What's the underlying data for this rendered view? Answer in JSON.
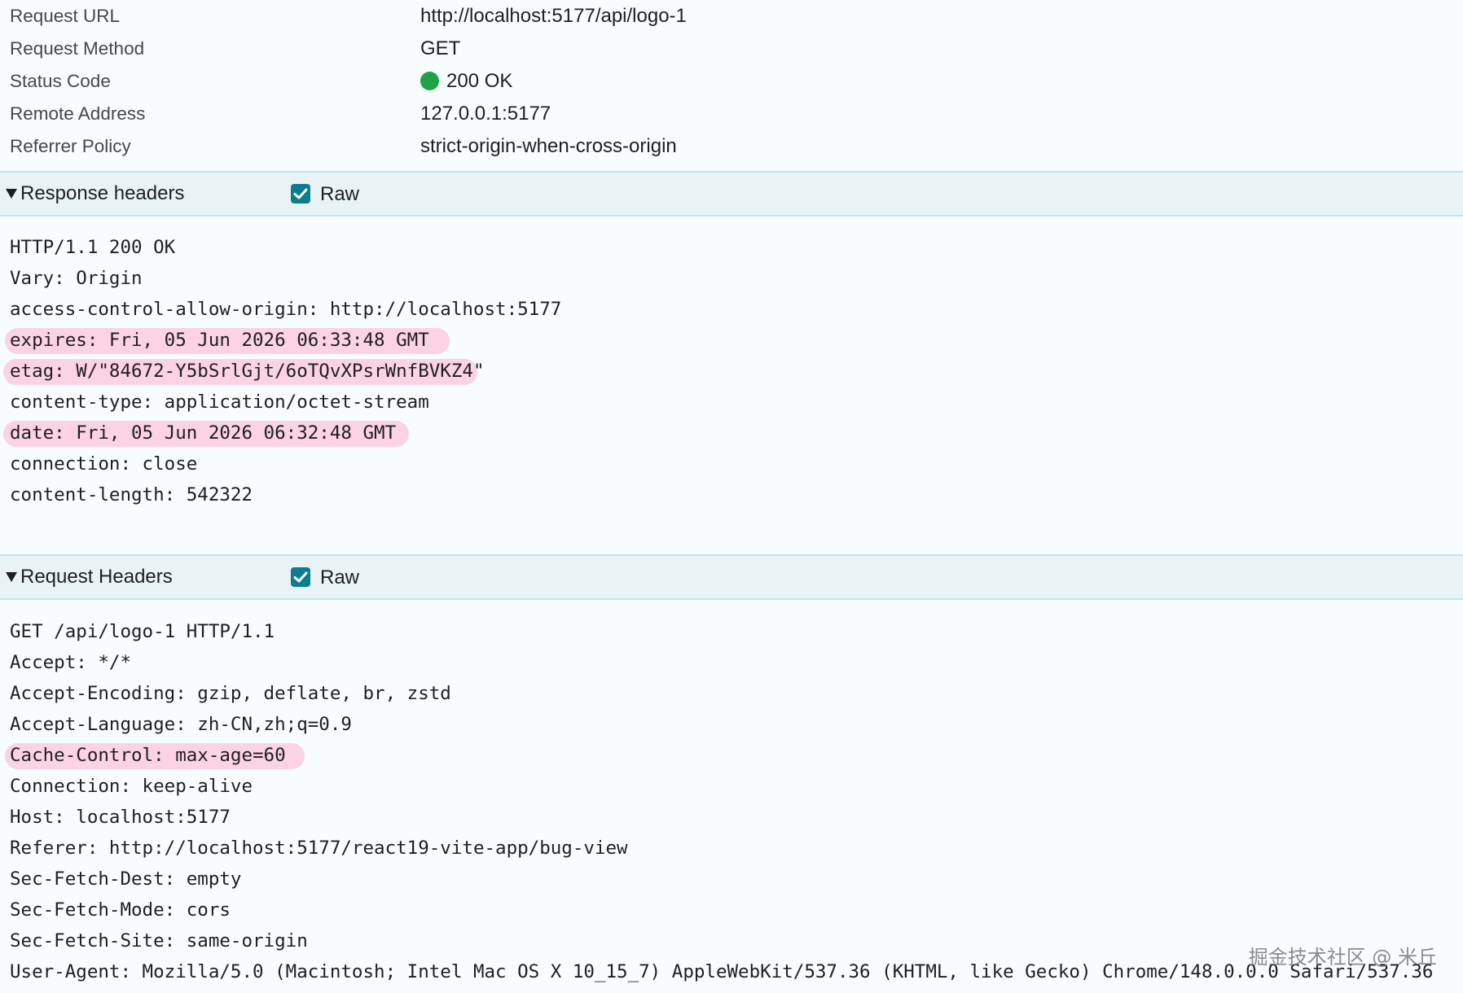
{
  "general": [
    {
      "key": "Request URL",
      "value": "http://localhost:5177/api/logo-1"
    },
    {
      "key": "Request Method",
      "value": "GET"
    },
    {
      "key": "Status Code",
      "value": "200 OK"
    },
    {
      "key": "Remote Address",
      "value": "127.0.0.1:5177"
    },
    {
      "key": "Referrer Policy",
      "value": "strict-origin-when-cross-origin"
    }
  ],
  "status_color": "#1ea446",
  "highlight_color": "#fbd3e3",
  "checkbox_color": "#0b7d8f",
  "response_headers": {
    "title": "Response headers",
    "raw_label": "Raw",
    "raw_checked": true,
    "lines": [
      "HTTP/1.1 200 OK",
      "Vary: Origin",
      "access-control-allow-origin: http://localhost:5177",
      "expires: Fri, 05 Jun 2026 06:33:48 GMT",
      "etag: W/\"84672-Y5bSrlGjt/6oTQvXPsrWnfBVKZ4\"",
      "content-type: application/octet-stream",
      "date: Fri, 05 Jun 2026 06:32:48 GMT",
      "connection: close",
      "content-length: 542322"
    ],
    "highlighted": [
      "expires: Fri, 05 Jun 2026 06:33:48 GMT",
      "etag: W/\"84672-Y5bSrlGjt/6oTQvXPsrWnfBVKZ4\"",
      "date: Fri, 05 Jun 2026 06:32:48 GMT"
    ]
  },
  "request_headers": {
    "title": "Request Headers",
    "raw_label": "Raw",
    "raw_checked": true,
    "lines": [
      "GET /api/logo-1 HTTP/1.1",
      "Accept: */*",
      "Accept-Encoding: gzip, deflate, br, zstd",
      "Accept-Language: zh-CN,zh;q=0.9",
      "Cache-Control: max-age=60",
      "Connection: keep-alive",
      "Host: localhost:5177",
      "Referer: http://localhost:5177/react19-vite-app/bug-view",
      "Sec-Fetch-Dest: empty",
      "Sec-Fetch-Mode: cors",
      "Sec-Fetch-Site: same-origin",
      "User-Agent: Mozilla/5.0 (Macintosh; Intel Mac OS X 10_15_7) AppleWebKit/537.36 (KHTML, like Gecko) Chrome/148.0.0.0 Safari/537.36"
    ],
    "highlighted": [
      "Cache-Control: max-age=60"
    ]
  },
  "watermark": "掘金技术社区 @ 米丘"
}
